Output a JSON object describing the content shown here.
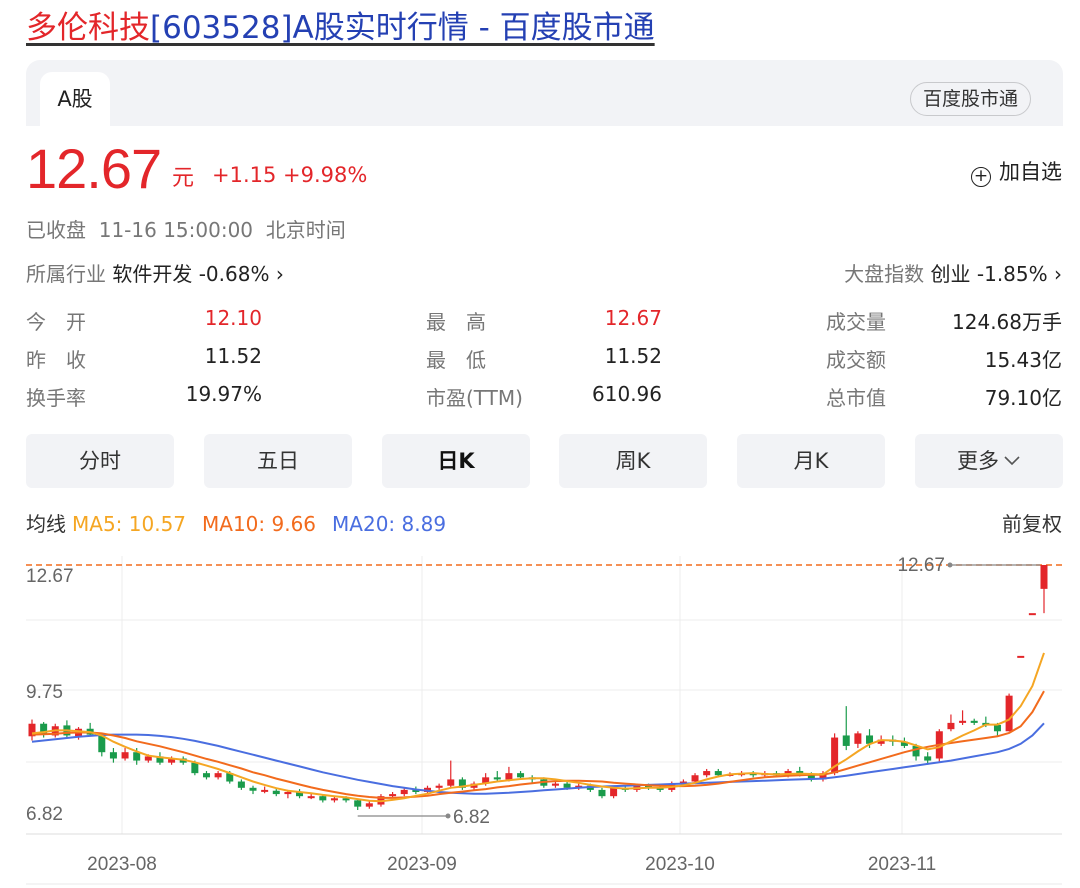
{
  "title": {
    "name": "多伦科技",
    "rest": "[603528]A股实时行情 - 百度股市通"
  },
  "tabs": {
    "a_share": "A股",
    "app": "百度股市通"
  },
  "quote": {
    "price": "12.67",
    "unit": "元",
    "change": "+1.15",
    "change_pct": "+9.98%",
    "watch_label": "加自选",
    "status": "已收盘",
    "datetime": "11-16 15:00:00",
    "timezone": "北京时间"
  },
  "industry": {
    "label": "所属行业",
    "value": "软件开发 -0.68% ›"
  },
  "index": {
    "label": "大盘指数",
    "value": "创业 -1.85% ›"
  },
  "stats": [
    {
      "label": "今　开",
      "value": "12.10",
      "red": true
    },
    {
      "label": "最　高",
      "value": "12.67",
      "red": true
    },
    {
      "label": "成交量",
      "value": "124.68万手",
      "red": false
    },
    {
      "label": "昨　收",
      "value": "11.52",
      "red": false
    },
    {
      "label": "最　低",
      "value": "11.52",
      "red": false
    },
    {
      "label": "成交额",
      "value": "15.43亿",
      "red": false
    },
    {
      "label": "换手率",
      "value": "19.97%",
      "red": false
    },
    {
      "label": "市盈(TTM)",
      "value": "610.96",
      "red": false
    },
    {
      "label": "总市值",
      "value": "79.10亿",
      "red": false
    }
  ],
  "periods": [
    "分时",
    "五日",
    "日K",
    "周K",
    "月K",
    "更多"
  ],
  "active_period": "日K",
  "ma": {
    "label": "均线",
    "ma5": "MA5: 10.57",
    "ma10": "MA10: 9.66",
    "ma20": "MA20: 8.89",
    "adjust": "前复权"
  },
  "colors": {
    "up": "#e3262a",
    "down": "#1a9b4b",
    "ma5": "#f5a623",
    "ma10": "#f26b1d",
    "ma20": "#4a6ee0"
  },
  "chart_data": {
    "type": "candlestick",
    "y_ticks": [
      "12.67",
      "9.75",
      "6.82"
    ],
    "ylim": [
      6.82,
      12.67
    ],
    "x_ticks": [
      "2023-08",
      "2023-09",
      "2023-10",
      "2023-11"
    ],
    "high_label": "12.67",
    "low_label": "6.82",
    "candles": [
      [
        8.58,
        8.88,
        8.98,
        8.48
      ],
      [
        8.88,
        8.62,
        8.92,
        8.55
      ],
      [
        8.6,
        8.82,
        8.88,
        8.55
      ],
      [
        8.84,
        8.6,
        8.96,
        8.55
      ],
      [
        8.58,
        8.76,
        8.8,
        8.5
      ],
      [
        8.76,
        8.62,
        8.9,
        8.58
      ],
      [
        8.6,
        8.2,
        8.65,
        8.1
      ],
      [
        8.2,
        8.05,
        8.3,
        7.95
      ],
      [
        8.05,
        8.2,
        8.3,
        8.0
      ],
      [
        8.2,
        8.0,
        8.3,
        7.9
      ],
      [
        8.0,
        8.1,
        8.15,
        7.95
      ],
      [
        8.1,
        7.95,
        8.2,
        7.9
      ],
      [
        7.95,
        8.05,
        8.1,
        7.9
      ],
      [
        8.05,
        7.95,
        8.1,
        7.9
      ],
      [
        7.95,
        7.7,
        8.0,
        7.65
      ],
      [
        7.7,
        7.6,
        7.75,
        7.55
      ],
      [
        7.6,
        7.7,
        7.75,
        7.55
      ],
      [
        7.7,
        7.5,
        7.75,
        7.45
      ],
      [
        7.5,
        7.35,
        7.55,
        7.3
      ],
      [
        7.35,
        7.28,
        7.4,
        7.2
      ],
      [
        7.3,
        7.3,
        7.38,
        7.22
      ],
      [
        7.28,
        7.2,
        7.32,
        7.15
      ],
      [
        7.2,
        7.25,
        7.3,
        7.1
      ],
      [
        7.25,
        7.15,
        7.32,
        7.1
      ],
      [
        7.15,
        7.15,
        7.22,
        7.08
      ],
      [
        7.15,
        7.05,
        7.2,
        7.0
      ],
      [
        7.05,
        7.1,
        7.15,
        7.0
      ],
      [
        7.1,
        7.05,
        7.15,
        7.0
      ],
      [
        7.05,
        6.9,
        7.08,
        6.82
      ],
      [
        6.9,
        6.98,
        7.05,
        6.85
      ],
      [
        6.95,
        7.15,
        7.2,
        6.9
      ],
      [
        7.15,
        7.2,
        7.25,
        7.1
      ],
      [
        7.2,
        7.3,
        7.35,
        7.15
      ],
      [
        7.3,
        7.25,
        7.38,
        7.2
      ],
      [
        7.25,
        7.35,
        7.4,
        7.2
      ],
      [
        7.35,
        7.4,
        7.45,
        7.3
      ],
      [
        7.4,
        7.55,
        8.0,
        7.35
      ],
      [
        7.55,
        7.35,
        7.6,
        7.3
      ],
      [
        7.35,
        7.45,
        7.5,
        7.3
      ],
      [
        7.45,
        7.6,
        7.7,
        7.4
      ],
      [
        7.6,
        7.55,
        7.75,
        7.5
      ],
      [
        7.55,
        7.7,
        7.85,
        7.5
      ],
      [
        7.7,
        7.6,
        7.75,
        7.55
      ],
      [
        7.6,
        7.55,
        7.65,
        7.45
      ],
      [
        7.55,
        7.4,
        7.6,
        7.35
      ],
      [
        7.4,
        7.45,
        7.5,
        7.35
      ],
      [
        7.45,
        7.35,
        7.5,
        7.3
      ],
      [
        7.35,
        7.4,
        7.45,
        7.3
      ],
      [
        7.4,
        7.3,
        7.45,
        7.25
      ],
      [
        7.3,
        7.15,
        7.35,
        7.1
      ],
      [
        7.15,
        7.35,
        7.4,
        7.1
      ],
      [
        7.35,
        7.3,
        7.4,
        7.25
      ],
      [
        7.3,
        7.4,
        7.45,
        7.25
      ],
      [
        7.4,
        7.35,
        7.45,
        7.3
      ],
      [
        7.35,
        7.3,
        7.4,
        7.25
      ],
      [
        7.3,
        7.45,
        7.5,
        7.25
      ],
      [
        7.45,
        7.5,
        7.55,
        7.4
      ],
      [
        7.5,
        7.65,
        7.7,
        7.45
      ],
      [
        7.65,
        7.75,
        7.8,
        7.6
      ],
      [
        7.75,
        7.65,
        7.8,
        7.6
      ],
      [
        7.65,
        7.68,
        7.72,
        7.62
      ],
      [
        7.68,
        7.7,
        7.75,
        7.62
      ],
      [
        7.7,
        7.65,
        7.75,
        7.6
      ],
      [
        7.65,
        7.7,
        7.75,
        7.6
      ],
      [
        7.7,
        7.65,
        7.75,
        7.6
      ],
      [
        7.65,
        7.75,
        7.8,
        7.6
      ],
      [
        7.75,
        7.68,
        7.85,
        7.62
      ],
      [
        7.68,
        7.55,
        7.72,
        7.5
      ],
      [
        7.55,
        7.7,
        7.75,
        7.5
      ],
      [
        7.7,
        8.55,
        8.65,
        7.65
      ],
      [
        8.6,
        8.35,
        9.3,
        8.25
      ],
      [
        8.4,
        8.65,
        8.7,
        8.3
      ],
      [
        8.6,
        8.4,
        8.75,
        8.3
      ],
      [
        8.4,
        8.5,
        8.6,
        8.35
      ],
      [
        8.5,
        8.45,
        8.6,
        8.35
      ],
      [
        8.45,
        8.35,
        8.55,
        8.3
      ],
      [
        8.35,
        8.1,
        8.4,
        8.0
      ],
      [
        8.1,
        8.0,
        8.2,
        7.9
      ],
      [
        8.05,
        8.7,
        8.75,
        7.95
      ],
      [
        8.75,
        8.9,
        9.1,
        8.7
      ],
      [
        8.9,
        8.95,
        9.2,
        8.85
      ],
      [
        8.95,
        8.9,
        9.0,
        8.85
      ],
      [
        8.9,
        8.85,
        9.05,
        8.8
      ],
      [
        8.85,
        8.7,
        8.9,
        8.6
      ],
      [
        8.7,
        9.55,
        9.6,
        8.7
      ],
      [
        10.5,
        10.5,
        10.5,
        10.5
      ],
      [
        11.52,
        11.52,
        11.52,
        11.52
      ],
      [
        12.1,
        12.67,
        12.67,
        11.52
      ]
    ],
    "ma5": [
      8.65,
      8.68,
      8.72,
      8.72,
      8.7,
      8.68,
      8.6,
      8.45,
      8.33,
      8.22,
      8.12,
      8.08,
      8.05,
      8.02,
      7.96,
      7.88,
      7.8,
      7.7,
      7.6,
      7.5,
      7.42,
      7.34,
      7.28,
      7.25,
      7.22,
      7.18,
      7.15,
      7.12,
      7.08,
      7.04,
      7.03,
      7.06,
      7.1,
      7.16,
      7.21,
      7.28,
      7.35,
      7.38,
      7.42,
      7.46,
      7.5,
      7.53,
      7.56,
      7.58,
      7.58,
      7.55,
      7.51,
      7.47,
      7.42,
      7.38,
      7.35,
      7.33,
      7.34,
      7.35,
      7.35,
      7.37,
      7.41,
      7.47,
      7.55,
      7.62,
      7.67,
      7.69,
      7.7,
      7.68,
      7.67,
      7.68,
      7.69,
      7.68,
      7.67,
      7.86,
      8.03,
      8.22,
      8.39,
      8.49,
      8.48,
      8.45,
      8.36,
      8.27,
      8.32,
      8.46,
      8.6,
      8.72,
      8.86,
      8.86,
      8.98,
      9.3,
      9.78,
      10.57
    ],
    "ma10": [
      8.62,
      8.63,
      8.64,
      8.66,
      8.67,
      8.67,
      8.65,
      8.6,
      8.54,
      8.46,
      8.4,
      8.34,
      8.27,
      8.2,
      8.12,
      8.04,
      7.97,
      7.89,
      7.81,
      7.72,
      7.65,
      7.57,
      7.5,
      7.43,
      7.36,
      7.3,
      7.25,
      7.2,
      7.16,
      7.13,
      7.11,
      7.11,
      7.12,
      7.14,
      7.16,
      7.2,
      7.23,
      7.26,
      7.29,
      7.32,
      7.36,
      7.39,
      7.43,
      7.46,
      7.49,
      7.51,
      7.52,
      7.52,
      7.51,
      7.5,
      7.47,
      7.45,
      7.43,
      7.41,
      7.4,
      7.39,
      7.39,
      7.4,
      7.42,
      7.45,
      7.49,
      7.53,
      7.57,
      7.6,
      7.62,
      7.64,
      7.65,
      7.66,
      7.66,
      7.72,
      7.8,
      7.88,
      7.96,
      8.04,
      8.12,
      8.2,
      8.27,
      8.33,
      8.38,
      8.42,
      8.46,
      8.5,
      8.54,
      8.58,
      8.66,
      8.82,
      9.16,
      9.66
    ],
    "ma20": [
      8.45,
      8.48,
      8.51,
      8.54,
      8.57,
      8.59,
      8.61,
      8.62,
      8.62,
      8.62,
      8.61,
      8.59,
      8.56,
      8.52,
      8.47,
      8.41,
      8.35,
      8.28,
      8.21,
      8.14,
      8.07,
      8.0,
      7.93,
      7.86,
      7.79,
      7.72,
      7.66,
      7.6,
      7.54,
      7.49,
      7.44,
      7.39,
      7.35,
      7.31,
      7.28,
      7.25,
      7.23,
      7.22,
      7.21,
      7.21,
      7.22,
      7.23,
      7.25,
      7.27,
      7.29,
      7.31,
      7.33,
      7.35,
      7.37,
      7.38,
      7.39,
      7.4,
      7.41,
      7.42,
      7.43,
      7.44,
      7.45,
      7.46,
      7.47,
      7.48,
      7.49,
      7.5,
      7.51,
      7.52,
      7.53,
      7.54,
      7.55,
      7.56,
      7.57,
      7.6,
      7.64,
      7.68,
      7.72,
      7.76,
      7.8,
      7.84,
      7.88,
      7.92,
      7.96,
      8.0,
      8.05,
      8.1,
      8.15,
      8.2,
      8.28,
      8.4,
      8.6,
      8.89
    ]
  }
}
